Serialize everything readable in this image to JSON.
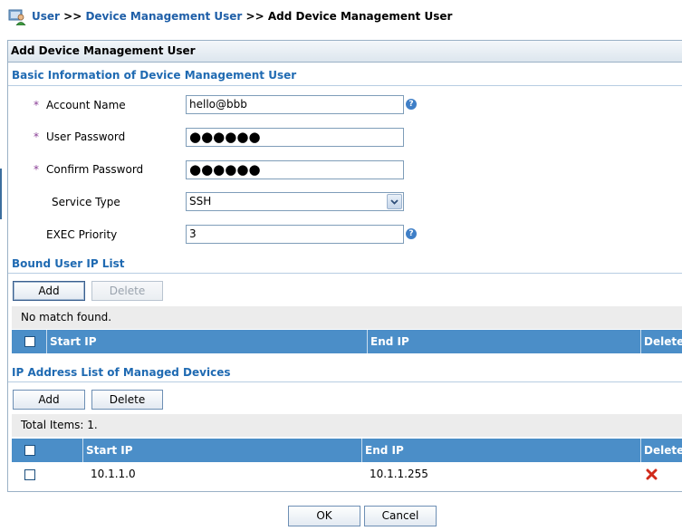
{
  "breadcrumb": {
    "items": [
      "User",
      "Device Management User",
      "Add Device Management User"
    ],
    "separator": ">>"
  },
  "panel": {
    "title": "Add Device Management User"
  },
  "basic_info": {
    "title": "Basic Information of Device Management User",
    "required_mark": "*",
    "account_name": {
      "label": "Account Name",
      "value": "hello@bbb"
    },
    "user_password": {
      "label": "User Password",
      "value": "●●●●●●"
    },
    "confirm_password": {
      "label": "Confirm Password",
      "value": "●●●●●●"
    },
    "service_type": {
      "label": "Service Type",
      "value": "SSH"
    },
    "exec_priority": {
      "label": "EXEC Priority",
      "value": "3"
    },
    "help_glyph": "?"
  },
  "bound_ip": {
    "title": "Bound User IP List",
    "add_label": "Add",
    "delete_label": "Delete",
    "status": "No match found.",
    "columns": [
      "Start IP",
      "End IP",
      "Delete"
    ]
  },
  "managed_devices": {
    "title": "IP Address List of Managed Devices",
    "add_label": "Add",
    "delete_label": "Delete",
    "status": "Total Items: 1.",
    "columns": [
      "Start IP",
      "End IP",
      "Delete"
    ],
    "rows": [
      {
        "start_ip": "10.1.1.0",
        "end_ip": "10.1.1.255"
      }
    ]
  },
  "footer": {
    "ok_label": "OK",
    "cancel_label": "Cancel"
  },
  "colors": {
    "accent": "#1f6ab2",
    "table_header": "#4b8ec8",
    "delete_icon": "#d02a1a"
  }
}
